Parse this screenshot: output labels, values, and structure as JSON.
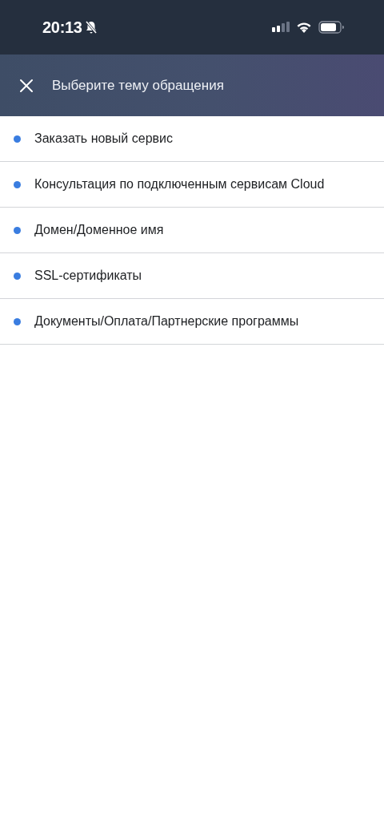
{
  "status_bar": {
    "time": "20:13"
  },
  "header": {
    "title": "Выберите тему обращения"
  },
  "topics": [
    {
      "label": "Заказать новый сервис"
    },
    {
      "label": "Консультация по подключенным сервисам Cloud"
    },
    {
      "label": "Домен/Доменное имя"
    },
    {
      "label": "SSL-сертификаты"
    },
    {
      "label": "Документы/Оплата/Партнерские программы"
    }
  ]
}
